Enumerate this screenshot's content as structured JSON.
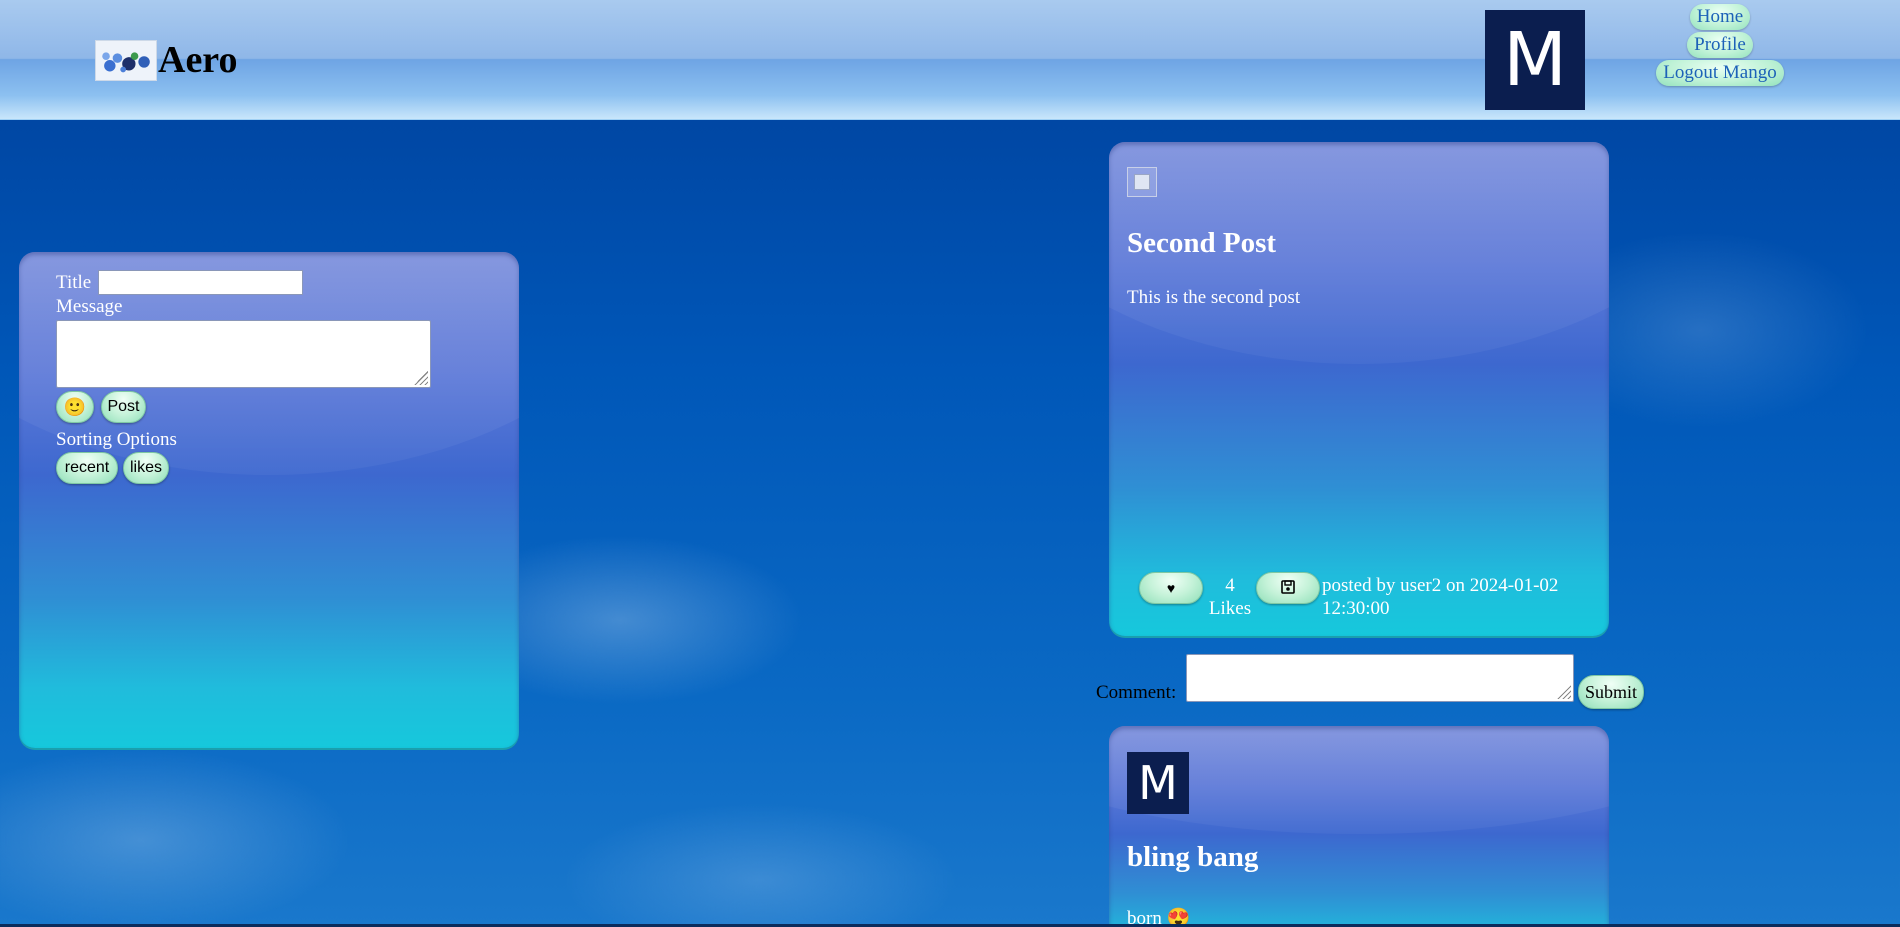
{
  "header": {
    "logo_text": "Aero",
    "avatar_letter": "M",
    "nav": [
      "Home",
      "Profile",
      "Logout Mango"
    ]
  },
  "compose": {
    "title_label": "Title",
    "title_value": "",
    "message_label": "Message",
    "message_value": "",
    "emoji_label": "🙂",
    "post_label": "Post",
    "sorting_label": "Sorting Options",
    "sort_buttons": [
      "recent",
      "likes"
    ]
  },
  "posts": [
    {
      "title": "Second Post",
      "body": "This is the second post",
      "like_icon": "♥",
      "likes": "4 Likes",
      "posted_by": "posted by user2 on 2024-01-02 12:30:00"
    },
    {
      "avatar_letter": "M",
      "title": "bling bang",
      "body": "born 😍"
    }
  ],
  "comment": {
    "label": "Comment:",
    "value": "",
    "submit_label": "Submit"
  },
  "colors": {
    "button_green": "#bff2d6",
    "nav_text": "#1d62b8",
    "avatar_bg": "#0b1e4f",
    "panel_top": "#7b8fdc",
    "panel_bottom": "#16c8dc"
  }
}
